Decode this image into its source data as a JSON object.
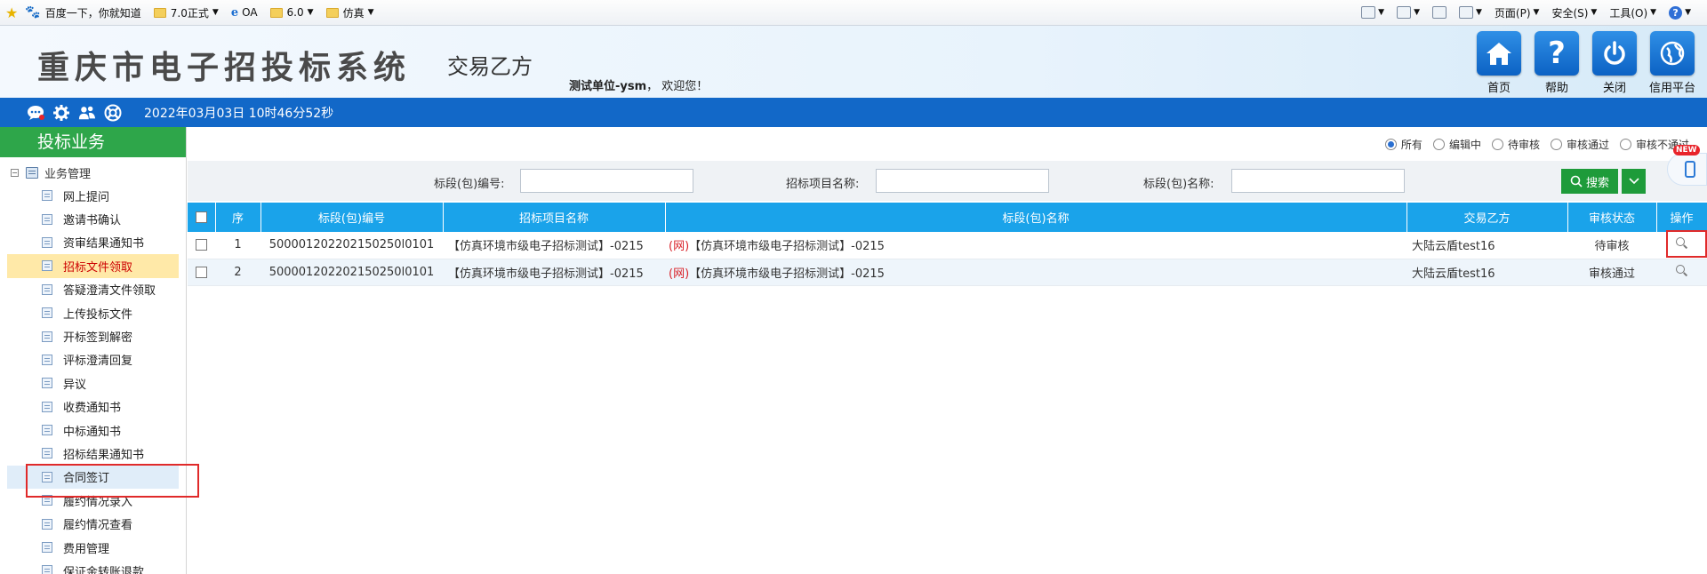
{
  "favorites": {
    "items": [
      {
        "label": "百度一下，你就知道",
        "icon": "paw-icon",
        "dropdown": false
      },
      {
        "label": "7.0正式",
        "icon": "folder-icon",
        "dropdown": true
      },
      {
        "label": "OA",
        "icon": "ie-icon",
        "dropdown": false
      },
      {
        "label": "6.0",
        "icon": "folder-icon",
        "dropdown": true
      },
      {
        "label": "仿真",
        "icon": "folder-icon",
        "dropdown": true
      }
    ],
    "tools": {
      "page": "页面(P)",
      "safety": "安全(S)",
      "tools": "工具(O)"
    }
  },
  "header": {
    "title": "重庆市电子招投标系统",
    "subtitle": "交易乙方",
    "user": "测试单位-ysm",
    "welcome_suffix": "，  欢迎您！",
    "buttons": [
      {
        "label": "首页",
        "icon": "home-icon"
      },
      {
        "label": "帮助",
        "icon": "help-icon"
      },
      {
        "label": "关闭",
        "icon": "power-icon"
      },
      {
        "label": "信用平台",
        "icon": "globe-icon"
      }
    ]
  },
  "toolbar": {
    "datetime": "2022年03月03日 10时46分52秒"
  },
  "sidebar": {
    "title": "投标业务",
    "root": "业务管理",
    "items": [
      "网上提问",
      "邀请书确认",
      "资审结果通知书",
      "招标文件领取",
      "答疑澄清文件领取",
      "上传投标文件",
      "开标签到解密",
      "评标澄清回复",
      "异议",
      "收费通知书",
      "中标通知书",
      "招标结果通知书",
      "合同签订",
      "履约情况录入",
      "履约情况查看",
      "费用管理",
      "保证金转账退款"
    ],
    "active_index": 3,
    "selected_index": 12
  },
  "filters": {
    "options": [
      "所有",
      "编辑中",
      "待审核",
      "审核通过",
      "审核不通过"
    ],
    "selected": 0
  },
  "search": {
    "section_code_label": "标段(包)编号:",
    "project_name_label": "招标项目名称:",
    "section_name_label": "标段(包)名称:",
    "section_code_value": "",
    "project_name_value": "",
    "section_name_value": "",
    "button_label": "搜索"
  },
  "table": {
    "headers": [
      "序",
      "标段(包)编号",
      "招标项目名称",
      "标段(包)名称",
      "交易乙方",
      "审核状态",
      "操作"
    ],
    "rows": [
      {
        "no": "1",
        "code": "500001202202150250l0101",
        "project": "【仿真环境市级电子招标测试】-0215",
        "prefix": "(网)",
        "section": "【仿真环境市级电子招标测试】-0215",
        "party": "大陆云盾test16",
        "status": "待审核"
      },
      {
        "no": "2",
        "code": "500001202202150250l0101",
        "project": "【仿真环境市级电子招标测试】-0215",
        "prefix": "(网)",
        "section": "【仿真环境市级电子招标测试】-0215",
        "party": "大陆云盾test16",
        "status": "审核通过"
      }
    ]
  },
  "widget": {
    "badge": "NEW"
  },
  "colors": {
    "header_blue": "#1268c8",
    "sidebar_green": "#2ea64a",
    "table_header": "#1aa3ea",
    "search_green": "#1e9b3a",
    "highlight_red": "#e02a2a"
  }
}
